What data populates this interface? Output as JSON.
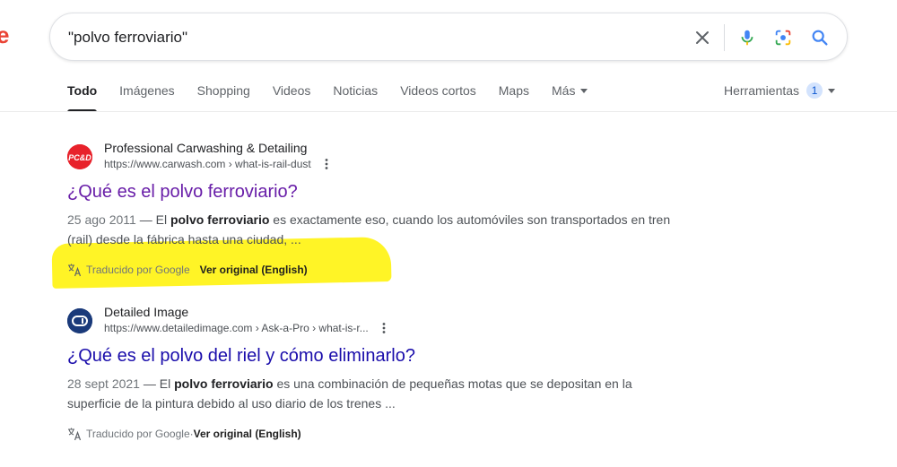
{
  "search": {
    "query": "\"polvo ferroviario\""
  },
  "tabs": [
    {
      "label": "Todo",
      "active": true
    },
    {
      "label": "Imágenes"
    },
    {
      "label": "Shopping"
    },
    {
      "label": "Videos"
    },
    {
      "label": "Noticias"
    },
    {
      "label": "Videos cortos"
    },
    {
      "label": "Maps"
    },
    {
      "label": "Más"
    }
  ],
  "tools": {
    "label": "Herramientas",
    "badge": "1"
  },
  "results": [
    {
      "favicon_text": "PC&D",
      "favicon_color": "#e8222b",
      "site_name": "Professional Carwashing & Detailing",
      "url": "https://www.carwash.com › what-is-rail-dust",
      "title": "¿Qué es el polvo ferroviario?",
      "date": "25 ago 2011",
      "dash": " — El ",
      "bold1": "polvo ferroviario",
      "line_after_bold1": " es exactamente eso, cuando los automóviles son transportados en tren (rail) desde la fábrica hasta una ciudad, ...",
      "translated_label": "Traducido por Google",
      "original_link": "Ver original (English)"
    },
    {
      "favicon_text": "DI",
      "favicon_color": "#1a3a7a",
      "site_name": "Detailed Image",
      "url": "https://www.detailedimage.com › Ask-a-Pro › what-is-r...",
      "title": "¿Qué es el polvo del riel y cómo eliminarlo?",
      "date": "28 sept 2021",
      "dash": " — El ",
      "bold1": "polvo ferroviario",
      "line_after_bold1": " es una combinación de pequeñas motas que se depositan en la superficie de la pintura debido al uso diario de los trenes ...",
      "translated_label": "Traducido por Google",
      "separator": " · ",
      "original_link": "Ver original (English)"
    }
  ],
  "colors": {
    "highlight": "#fff200",
    "visited_title": "#681da8",
    "link_title": "#1a0dab"
  }
}
